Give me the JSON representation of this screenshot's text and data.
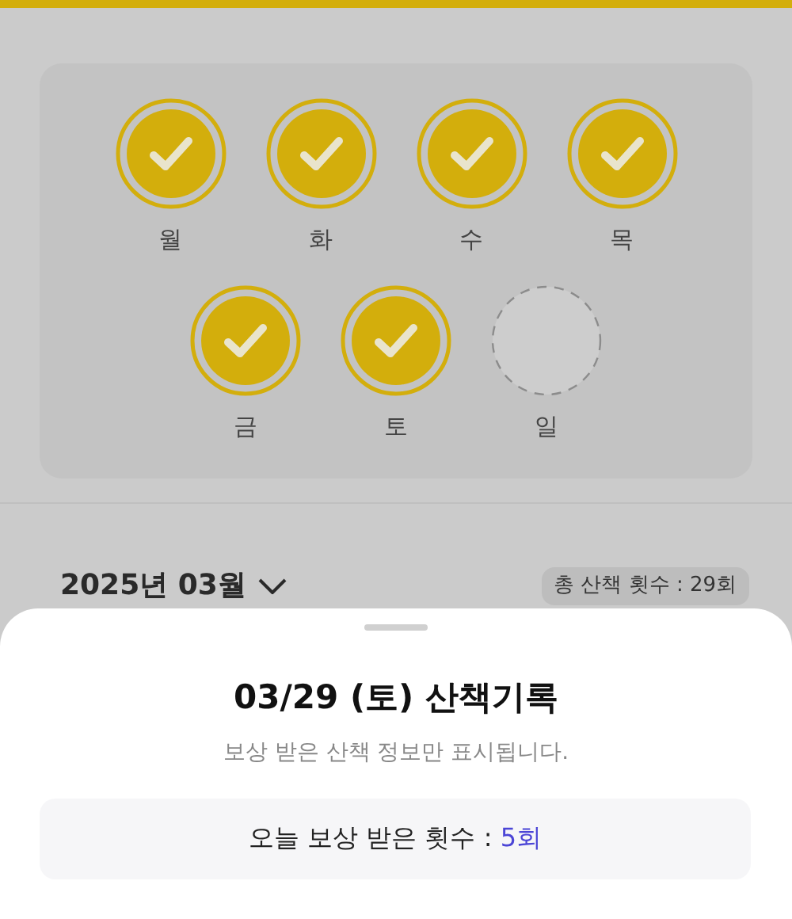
{
  "week": [
    {
      "label": "월",
      "checked": true
    },
    {
      "label": "화",
      "checked": true
    },
    {
      "label": "수",
      "checked": true
    },
    {
      "label": "목",
      "checked": true
    },
    {
      "label": "금",
      "checked": true
    },
    {
      "label": "토",
      "checked": true
    },
    {
      "label": "일",
      "checked": false
    }
  ],
  "month": {
    "label": "2025년 03월",
    "total": "총 산책 횟수 : 29회"
  },
  "sheet": {
    "title": "03/29 (토) 산책기록",
    "subtitle": "보상 받은 산책 정보만 표시됩니다.",
    "count_label": "오늘 보상 받은 횟수 : ",
    "count_value": "5회"
  }
}
